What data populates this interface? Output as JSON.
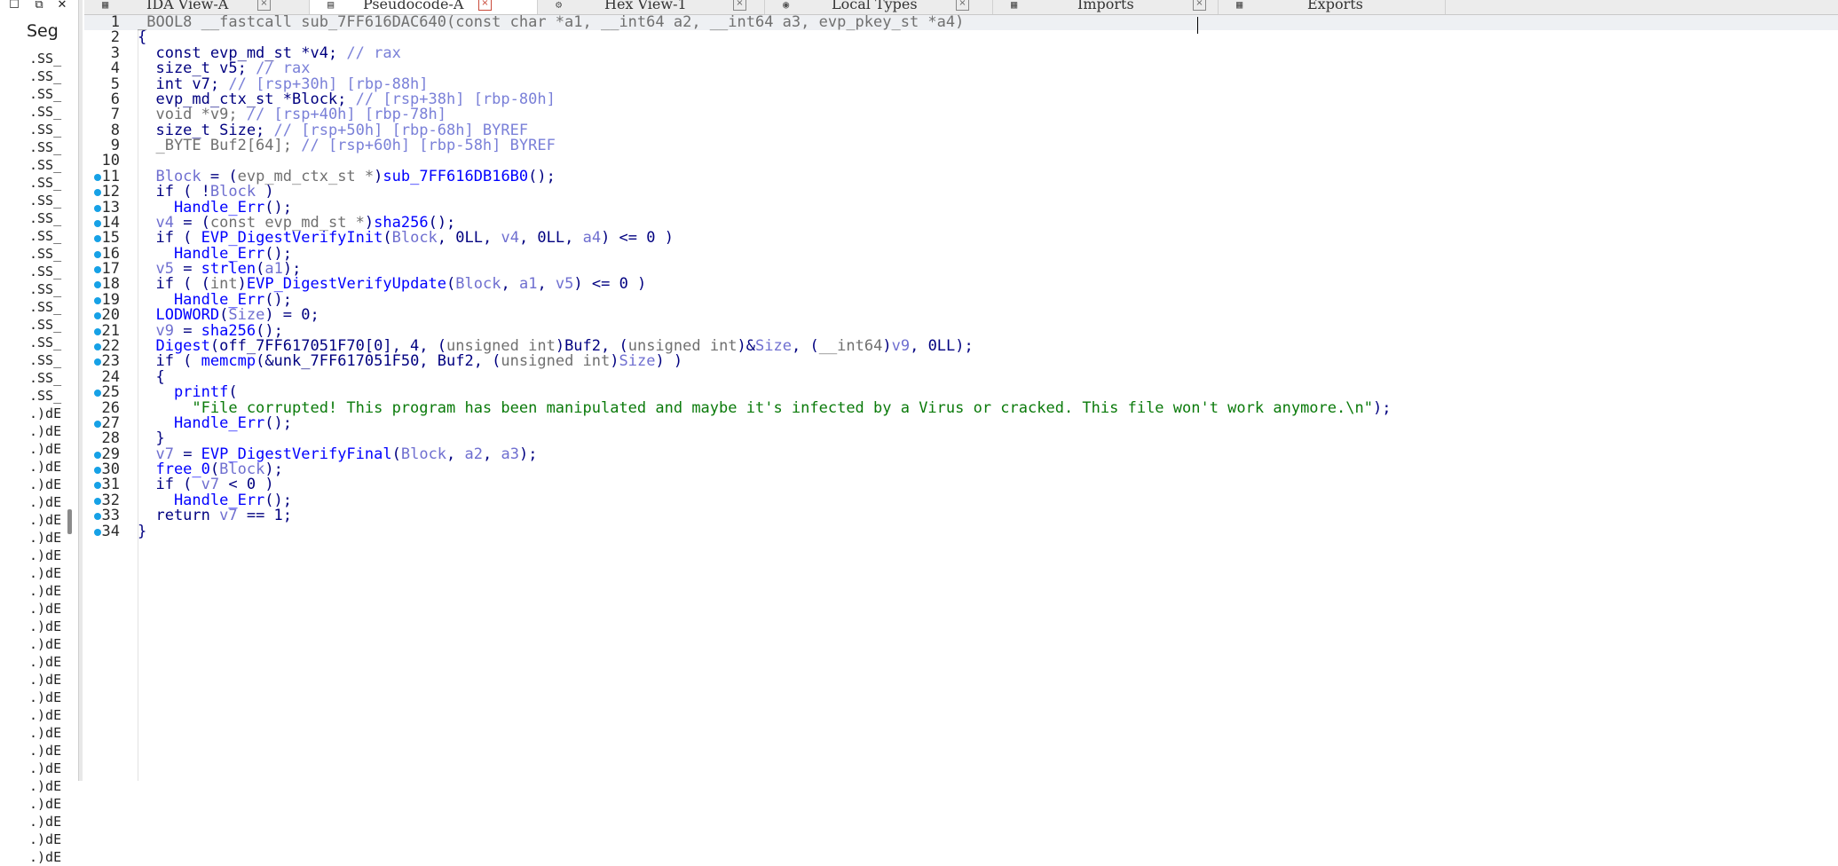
{
  "left_panel": {
    "header": "Seg",
    "items": [
      ".SS_",
      ".SS_",
      ".SS_",
      ".SS_",
      ".SS_",
      ".SS_",
      ".SS_",
      ".SS_",
      ".SS_",
      ".SS_",
      ".SS_",
      ".SS_",
      ".SS_",
      ".SS_",
      ".SS_",
      ".SS_",
      ".SS_",
      ".SS_",
      ".SS_",
      ".SS_",
      ".)dE",
      ".)dE",
      ".)dE",
      ".)dE",
      ".)dE",
      ".)dE",
      ".)dE",
      ".)dE",
      ".)dE",
      ".)dE",
      ".)dE",
      ".)dE",
      ".)dE",
      ".)dE",
      ".)dE",
      ".)dE",
      ".)dE",
      ".)dE",
      ".)dE",
      ".)dE",
      ".)dE",
      ".)dE",
      ".)dE",
      ".)dE",
      ".)dE",
      ".)dE"
    ]
  },
  "tabs": [
    {
      "label": "IDA View-A",
      "icon": "graph-icon",
      "active": false
    },
    {
      "label": "Pseudocode-A",
      "icon": "pseudocode-icon",
      "active": true
    },
    {
      "label": "Hex View-1",
      "icon": "hex-icon",
      "active": false
    },
    {
      "label": "Local Types",
      "icon": "types-icon",
      "active": false
    },
    {
      "label": "Imports",
      "icon": "imports-icon",
      "active": false
    },
    {
      "label": "Exports",
      "icon": "exports-icon",
      "active": false
    }
  ],
  "code_lines": [
    {
      "n": "1",
      "bp": false,
      "t": [
        [
          "g",
          "_BOOL8 __fastcall sub_7FF616DAC640(const char *a1, __int64 a2, __int64 a3, evp_pkey_st *a4)"
        ]
      ]
    },
    {
      "n": "2",
      "bp": false,
      "t": [
        [
          "k",
          "{"
        ]
      ]
    },
    {
      "n": "3",
      "bp": false,
      "t": [
        [
          "k",
          "  const evp_md_st *v4; "
        ],
        [
          "c",
          "// rax"
        ]
      ]
    },
    {
      "n": "4",
      "bp": false,
      "t": [
        [
          "k",
          "  size_t v5; "
        ],
        [
          "c",
          "// rax"
        ]
      ]
    },
    {
      "n": "5",
      "bp": false,
      "t": [
        [
          "k",
          "  int v7; "
        ],
        [
          "c",
          "// [rsp+30h] [rbp-88h]"
        ]
      ]
    },
    {
      "n": "6",
      "bp": false,
      "t": [
        [
          "k",
          "  evp_md_ctx_st *Block; "
        ],
        [
          "c",
          "// [rsp+38h] [rbp-80h]"
        ]
      ]
    },
    {
      "n": "7",
      "bp": false,
      "t": [
        [
          "g",
          "  void *v9; "
        ],
        [
          "c",
          "// [rsp+40h] [rbp-78h]"
        ]
      ]
    },
    {
      "n": "8",
      "bp": false,
      "t": [
        [
          "k",
          "  size_t Size; "
        ],
        [
          "c",
          "// [rsp+50h] [rbp-68h] BYREF"
        ]
      ]
    },
    {
      "n": "9",
      "bp": false,
      "t": [
        [
          "g",
          "  _BYTE Buf2[64]; "
        ],
        [
          "c",
          "// [rsp+60h] [rbp-58h] BYREF"
        ]
      ]
    },
    {
      "n": "10",
      "bp": false,
      "t": [
        [
          "k",
          ""
        ]
      ]
    },
    {
      "n": "11",
      "bp": true,
      "t": [
        [
          "v",
          "  Block"
        ],
        [
          "k",
          " = ("
        ],
        [
          "g",
          "evp_md_ctx_st *"
        ],
        [
          "k",
          ")"
        ],
        [
          "f",
          "sub_7FF616DB16B0"
        ],
        [
          "k",
          "();"
        ]
      ]
    },
    {
      "n": "12",
      "bp": true,
      "t": [
        [
          "k",
          "  if ( !"
        ],
        [
          "v",
          "Block"
        ],
        [
          "k",
          " )"
        ]
      ]
    },
    {
      "n": "13",
      "bp": true,
      "t": [
        [
          "f",
          "    Handle_Err"
        ],
        [
          "k",
          "();"
        ]
      ]
    },
    {
      "n": "14",
      "bp": true,
      "t": [
        [
          "v",
          "  v4"
        ],
        [
          "k",
          " = ("
        ],
        [
          "g",
          "const evp_md_st *"
        ],
        [
          "k",
          ")"
        ],
        [
          "f",
          "sha256"
        ],
        [
          "k",
          "();"
        ]
      ]
    },
    {
      "n": "15",
      "bp": true,
      "t": [
        [
          "k",
          "  if ( "
        ],
        [
          "f",
          "EVP_DigestVerifyInit"
        ],
        [
          "k",
          "("
        ],
        [
          "v",
          "Block"
        ],
        [
          "k",
          ", 0LL, "
        ],
        [
          "v",
          "v4"
        ],
        [
          "k",
          ", 0LL, "
        ],
        [
          "v",
          "a4"
        ],
        [
          "k",
          ") <= 0 )"
        ]
      ]
    },
    {
      "n": "16",
      "bp": true,
      "t": [
        [
          "f",
          "    Handle_Err"
        ],
        [
          "k",
          "();"
        ]
      ]
    },
    {
      "n": "17",
      "bp": true,
      "t": [
        [
          "v",
          "  v5"
        ],
        [
          "k",
          " = "
        ],
        [
          "f",
          "strlen"
        ],
        [
          "k",
          "("
        ],
        [
          "v",
          "a1"
        ],
        [
          "k",
          ");"
        ]
      ]
    },
    {
      "n": "18",
      "bp": true,
      "t": [
        [
          "k",
          "  if ( ("
        ],
        [
          "g",
          "int"
        ],
        [
          "k",
          ")"
        ],
        [
          "f",
          "EVP_DigestVerifyUpdate"
        ],
        [
          "k",
          "("
        ],
        [
          "v",
          "Block"
        ],
        [
          "k",
          ", "
        ],
        [
          "v",
          "a1"
        ],
        [
          "k",
          ", "
        ],
        [
          "v",
          "v5"
        ],
        [
          "k",
          ") <= 0 )"
        ]
      ]
    },
    {
      "n": "19",
      "bp": true,
      "t": [
        [
          "f",
          "    Handle_Err"
        ],
        [
          "k",
          "();"
        ]
      ]
    },
    {
      "n": "20",
      "bp": true,
      "t": [
        [
          "f",
          "  LODWORD"
        ],
        [
          "k",
          "("
        ],
        [
          "v",
          "Size"
        ],
        [
          "k",
          ") = 0;"
        ]
      ]
    },
    {
      "n": "21",
      "bp": true,
      "t": [
        [
          "v",
          "  v9"
        ],
        [
          "k",
          " = "
        ],
        [
          "f",
          "sha256"
        ],
        [
          "k",
          "();"
        ]
      ]
    },
    {
      "n": "22",
      "bp": true,
      "t": [
        [
          "f",
          "  Digest"
        ],
        [
          "k",
          "(off_7FF617051F70[0], 4, ("
        ],
        [
          "g",
          "unsigned int"
        ],
        [
          "k",
          ")Buf2, ("
        ],
        [
          "g",
          "unsigned int"
        ],
        [
          "k",
          ")&"
        ],
        [
          "v",
          "Size"
        ],
        [
          "k",
          ", ("
        ],
        [
          "g",
          "__int64"
        ],
        [
          "k",
          ")"
        ],
        [
          "v",
          "v9"
        ],
        [
          "k",
          ", 0LL);"
        ]
      ]
    },
    {
      "n": "23",
      "bp": true,
      "t": [
        [
          "k",
          "  if ( "
        ],
        [
          "f",
          "memcmp"
        ],
        [
          "k",
          "(&unk_7FF617051F50, Buf2, ("
        ],
        [
          "g",
          "unsigned int"
        ],
        [
          "k",
          ")"
        ],
        [
          "v",
          "Size"
        ],
        [
          "k",
          ") )"
        ]
      ]
    },
    {
      "n": "24",
      "bp": false,
      "t": [
        [
          "k",
          "  {"
        ]
      ]
    },
    {
      "n": "25",
      "bp": true,
      "t": [
        [
          "f",
          "    printf"
        ],
        [
          "k",
          "("
        ]
      ]
    },
    {
      "n": "26",
      "bp": false,
      "t": [
        [
          "s",
          "      \"File corrupted! This program has been manipulated and maybe it's infected by a Virus or cracked. This file won't work anymore.\\n\""
        ],
        [
          "k",
          ");"
        ]
      ]
    },
    {
      "n": "27",
      "bp": true,
      "t": [
        [
          "f",
          "    Handle_Err"
        ],
        [
          "k",
          "();"
        ]
      ]
    },
    {
      "n": "28",
      "bp": false,
      "t": [
        [
          "k",
          "  }"
        ]
      ]
    },
    {
      "n": "29",
      "bp": true,
      "t": [
        [
          "v",
          "  v7"
        ],
        [
          "k",
          " = "
        ],
        [
          "f",
          "EVP_DigestVerifyFinal"
        ],
        [
          "k",
          "("
        ],
        [
          "v",
          "Block"
        ],
        [
          "k",
          ", "
        ],
        [
          "v",
          "a2"
        ],
        [
          "k",
          ", "
        ],
        [
          "v",
          "a3"
        ],
        [
          "k",
          ");"
        ]
      ]
    },
    {
      "n": "30",
      "bp": true,
      "t": [
        [
          "f",
          "  free_0"
        ],
        [
          "k",
          "("
        ],
        [
          "v",
          "Block"
        ],
        [
          "k",
          ");"
        ]
      ]
    },
    {
      "n": "31",
      "bp": true,
      "t": [
        [
          "k",
          "  if ( "
        ],
        [
          "v",
          "v7"
        ],
        [
          "k",
          " < 0 )"
        ]
      ]
    },
    {
      "n": "32",
      "bp": true,
      "t": [
        [
          "f",
          "    Handle_Err"
        ],
        [
          "k",
          "();"
        ]
      ]
    },
    {
      "n": "33",
      "bp": true,
      "t": [
        [
          "k",
          "  return "
        ],
        [
          "v",
          "v7"
        ],
        [
          "k",
          " == 1;"
        ]
      ]
    },
    {
      "n": "34",
      "bp": true,
      "t": [
        [
          "k",
          "}"
        ]
      ]
    }
  ]
}
